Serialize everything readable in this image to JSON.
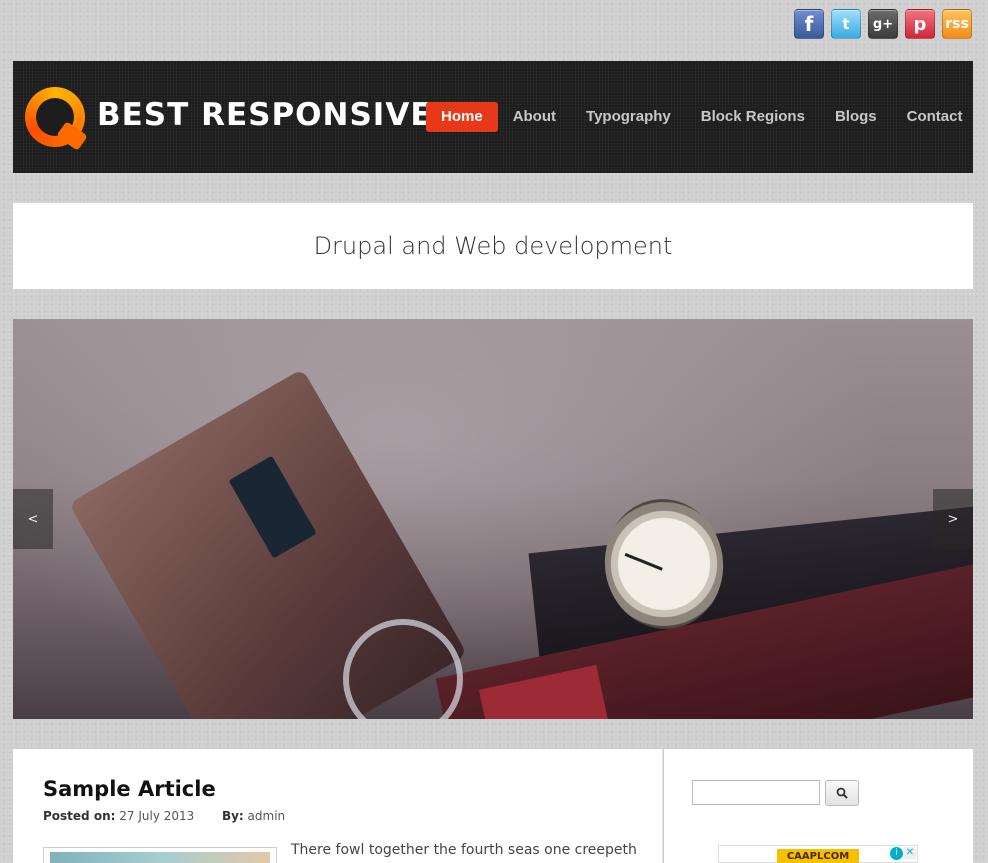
{
  "social": [
    {
      "name": "facebook",
      "glyph": "f"
    },
    {
      "name": "twitter",
      "glyph": "t"
    },
    {
      "name": "googleplus",
      "glyph": "g+"
    },
    {
      "name": "pinterest",
      "glyph": "p"
    },
    {
      "name": "rss",
      "glyph": "rss"
    }
  ],
  "header": {
    "site_name": "BEST RESPONSIVE",
    "nav": [
      "Home",
      "About",
      "Typography",
      "Block Regions",
      "Blogs",
      "Contact"
    ],
    "active_nav": "Home"
  },
  "tagline": "Drupal and Web development",
  "slider": {
    "prev_label": "<",
    "next_label": ">"
  },
  "article": {
    "title": "Sample Article",
    "posted_label": "Posted on:",
    "date": "27 July 2013",
    "by_label": "By:",
    "author": "admin",
    "excerpt": "There fowl together the fourth seas one creepeth"
  },
  "sidebar": {
    "search_value": "",
    "ad": {
      "banner_text": "CAAPLCOM",
      "adchoices_glyph": "i",
      "close_glyph": "✕"
    }
  },
  "colors": {
    "accent": "#e8381a",
    "header_bg": "#1d1d1d",
    "page_bg": "#cfcfcf"
  }
}
